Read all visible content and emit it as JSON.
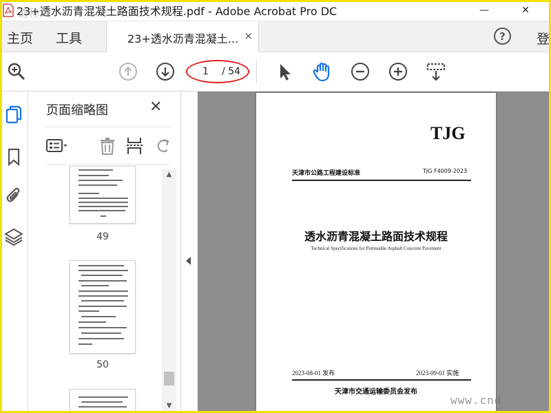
{
  "window": {
    "title": "23+透水沥青混凝土路面技术规程.pdf - Adobe Acrobat Pro DC",
    "minimize": "—",
    "close": "✕",
    "app_icon": "acrobat-pdf-icon"
  },
  "watermarks": {
    "top_left": "道称网",
    "bottom_right": "www.cnd"
  },
  "nav": {
    "home": "主页",
    "tools": "工具",
    "doc_tab": "23+透水沥青混凝土...",
    "doc_tab_close": "×",
    "help": "?",
    "login": "登"
  },
  "toolbar": {
    "page_current": "1",
    "page_total": "/ 54",
    "icons": [
      "zoom-search-icon",
      "page-up-icon",
      "page-down-icon",
      "select-arrow-icon",
      "hand-pan-icon",
      "zoom-out-icon",
      "zoom-in-icon",
      "marquee-zoom-icon"
    ],
    "highlight_color": "#e0201e"
  },
  "sidebar": {
    "icons": [
      "page-thumbnails-icon",
      "bookmark-icon",
      "attachment-icon",
      "layers-icon"
    ],
    "accent": "#1473e6"
  },
  "panel": {
    "title": "页面缩略图",
    "close": "✕",
    "thumbnails": [
      {
        "label": "49"
      },
      {
        "label": "50"
      },
      {
        "label": ""
      }
    ]
  },
  "document": {
    "code_mark": "TJG",
    "standard_category": "天津市公路工程建设标准",
    "standard_code": "TJG F4009-2023",
    "title": "透水沥青混凝土路面技术规程",
    "subtitle": "Technical Specifications for Permeable Asphalt Concrete Pavement",
    "issue_date": "2023-08-01 发布",
    "effective_date": "2023-09-01 实施",
    "publisher": "天津市交通运输委员会发布"
  },
  "colors": {
    "frame": "#f2e100",
    "doc_background": "#8e8e8e",
    "icon_blue": "#1473e6"
  }
}
